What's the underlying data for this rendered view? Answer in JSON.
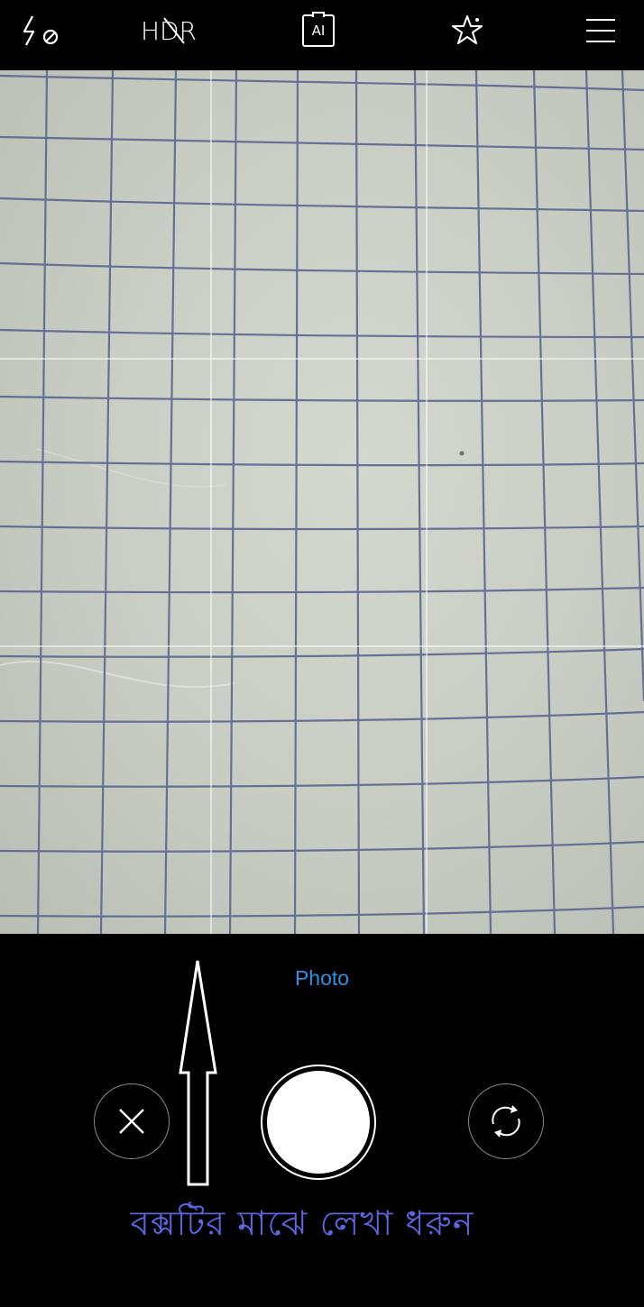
{
  "topbar": {
    "flash": {
      "icon": "flash-off-icon"
    },
    "hdr": {
      "label": "HDR",
      "state": "off"
    },
    "ai": {
      "label": "AI"
    },
    "beauty": {
      "icon": "beauty-star-icon"
    },
    "menu": {
      "icon": "menu-icon"
    }
  },
  "viewfinder": {
    "grid_overlay": "3x3"
  },
  "bottom": {
    "mode_label": "Photo",
    "mode_color": "#2f8fe0",
    "cancel_icon": "close-icon",
    "shutter_icon": "shutter-button",
    "switch_icon": "switch-camera-icon"
  },
  "annotation": {
    "instruction": "বক্সটির মাঝে লেখা ধরুন",
    "instruction_color": "#5a67e0"
  }
}
